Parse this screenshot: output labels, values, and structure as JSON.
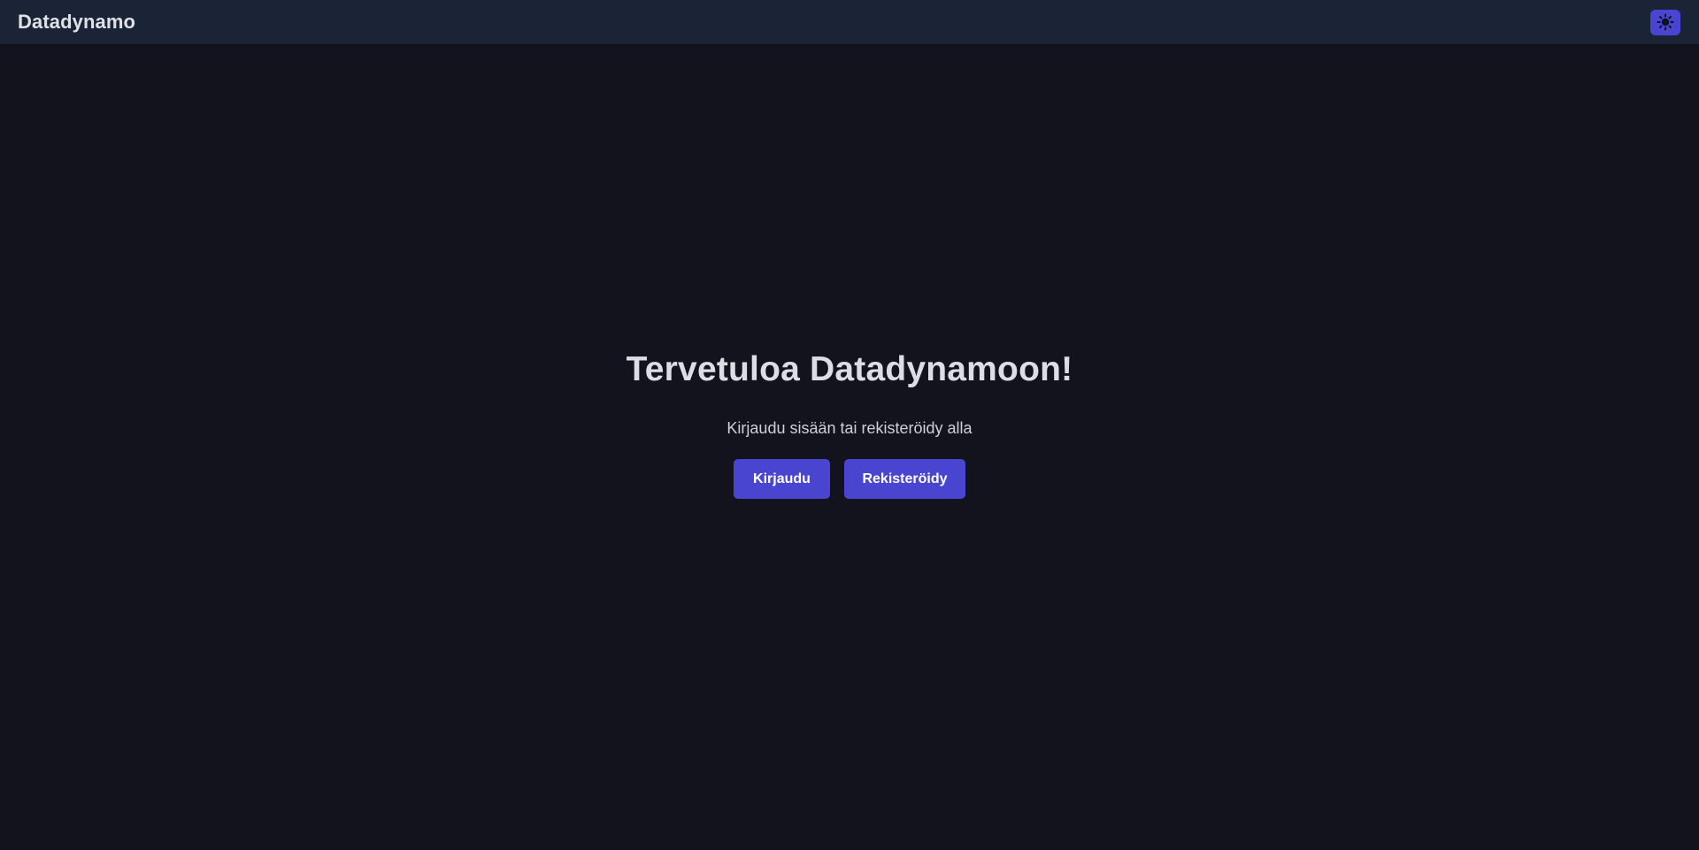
{
  "app": {
    "brand": "Datadynamo"
  },
  "header": {
    "theme_toggle_icon": "sun-icon"
  },
  "hero": {
    "title": "Tervetuloa Datadynamoon!",
    "subtitle": "Kirjaudu sisään tai rekisteröidy alla",
    "login_label": "Kirjaudu",
    "register_label": "Rekisteröidy"
  },
  "colors": {
    "background": "#12131c",
    "navbar": "#1b2437",
    "accent": "#4a45d1",
    "text": "#dcdee4"
  }
}
